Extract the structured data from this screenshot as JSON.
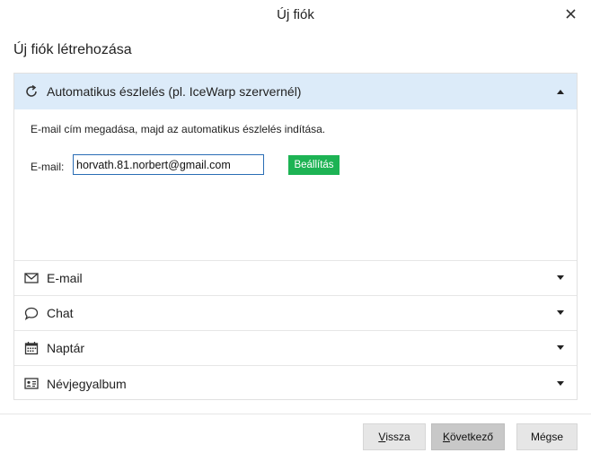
{
  "window": {
    "title": "Új fiók",
    "close_icon": "close-icon"
  },
  "heading": "Új fiók létrehozása",
  "sections": [
    {
      "id": "auto",
      "label": "Automatikus észlelés (pl. IceWarp szervernél)",
      "icon": "refresh-icon",
      "expanded": true
    },
    {
      "id": "email",
      "label": "E-mail",
      "icon": "envelope-icon",
      "expanded": false
    },
    {
      "id": "chat",
      "label": "Chat",
      "icon": "chat-bubble-icon",
      "expanded": false
    },
    {
      "id": "calendar",
      "label": "Naptár",
      "icon": "calendar-icon",
      "expanded": false
    },
    {
      "id": "contacts",
      "label": "Névjegyalbum",
      "icon": "contact-card-icon",
      "expanded": false
    }
  ],
  "auto_detect": {
    "description": "E-mail cím megadása, majd az automatikus észlelés indítása.",
    "email_label": "E-mail:",
    "email_value": "horvath.81.norbert@gmail.com",
    "setup_button": "Beállítás"
  },
  "footer": {
    "back": {
      "mnemonic": "V",
      "rest": "issza"
    },
    "next": {
      "mnemonic": "K",
      "rest": "övetkező"
    },
    "cancel": "Mégse"
  },
  "colors": {
    "active_section_bg": "#dcebf9",
    "setup_button_bg": "#1db354",
    "input_border": "#2a6db5"
  }
}
